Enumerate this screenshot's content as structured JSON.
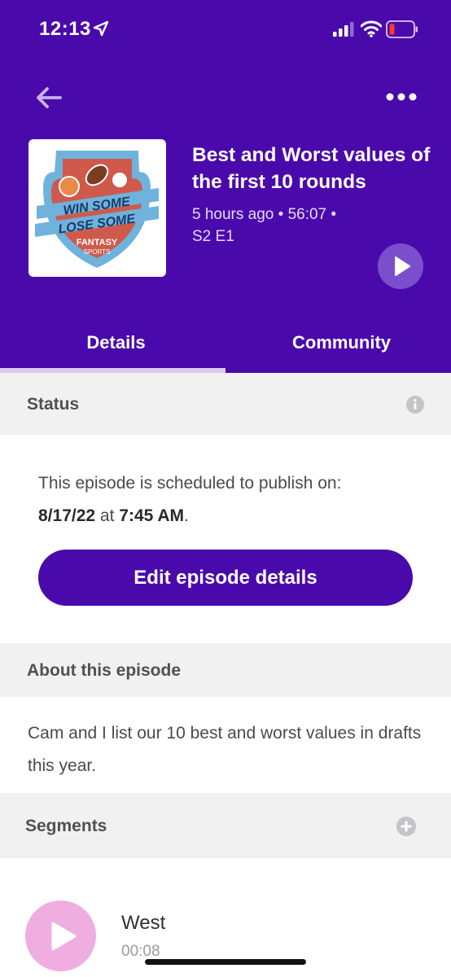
{
  "status_bar": {
    "time": "12:13"
  },
  "episode": {
    "cover_art": {
      "line1": "WIN SOME",
      "line2": "LOSE SOME",
      "line3": "FANTASY",
      "line4": "SPORTS"
    },
    "title": "Best and Worst values of the first 10 rounds",
    "meta_line1": "5 hours ago • 56:07 •",
    "meta_line2": "S2 E1"
  },
  "tabs": [
    {
      "label": "Details",
      "active": true
    },
    {
      "label": "Community",
      "active": false
    }
  ],
  "status_section": {
    "header": "Status",
    "text_prefix": "This episode is scheduled to publish on:",
    "date": "8/17/22",
    "at": "at",
    "time": "7:45 AM",
    "period": "."
  },
  "edit_button_label": "Edit episode details",
  "about_section": {
    "header": "About this episode",
    "text": "Cam and I list our 10 best and worst values in drafts this year."
  },
  "segments_section": {
    "header": "Segments",
    "items": [
      {
        "name": "West",
        "duration": "00:08"
      }
    ]
  },
  "colors": {
    "brand_purple": "#4a0aab",
    "play_button": "#7a4fce",
    "segment_play": "#f0aee0",
    "section_bg": "#f1f1f2"
  }
}
